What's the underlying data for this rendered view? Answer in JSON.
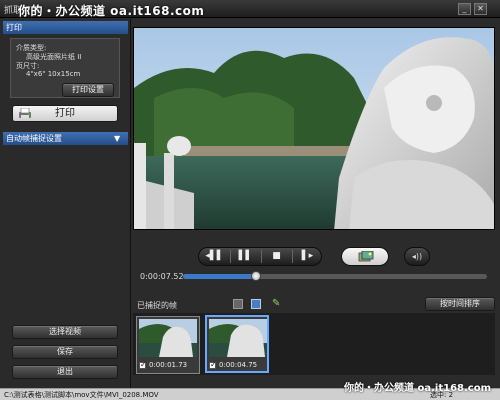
{
  "window": {
    "title": "抓取打印",
    "watermark_top": "你的・办公频道 oa.it168.com",
    "watermark_bottom": "你的・办公频道 oa.it168.com"
  },
  "print_section": {
    "header": "打印",
    "media_type_label": "介质类型:",
    "media_type_value": "高级光面照片纸 II",
    "page_size_label": "页尺寸:",
    "page_size_value": "4\"x6\" 10x15cm",
    "settings_button": "打印设置",
    "print_button": "打印"
  },
  "auto_capture_section": {
    "header": "自动帧捕捉设置"
  },
  "left_buttons": {
    "select_video": "选择视频",
    "save": "保存",
    "exit": "退出"
  },
  "player": {
    "current_time": "0:00:07.52",
    "progress_fraction": 0.24
  },
  "frames": {
    "label": "已捕捉的帧",
    "sort_button": "按时间排序",
    "items": [
      {
        "time": "0:00:01.73",
        "checked": true,
        "selected": false
      },
      {
        "time": "0:00:04.75",
        "checked": true,
        "selected": true
      }
    ]
  },
  "status": {
    "file_path": "C:\\测试表格\\测试脚本\\mov文件\\MVI_0208.MOV",
    "selected_label": "选中: 2"
  },
  "colors": {
    "accent_blue": "#3d78c9",
    "header_blue": "#2f5fa5"
  }
}
